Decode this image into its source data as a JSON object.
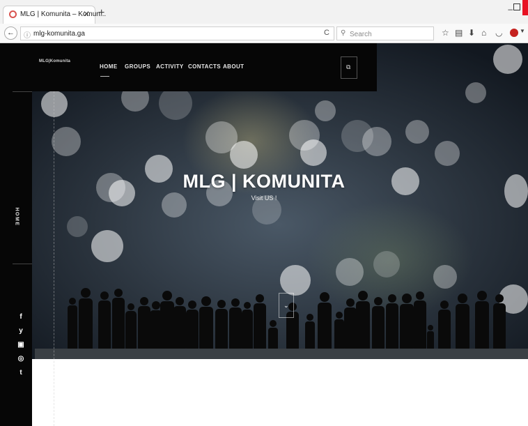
{
  "browser": {
    "tab_title": "MLG | Komunita – Komun...",
    "tab_close": "✕",
    "new_tab": "+",
    "minimize": "–",
    "url": "mlg-komunita.ga",
    "search_placeholder": "Search",
    "back_icon": "←",
    "reload_icon": "C"
  },
  "site": {
    "logo": "MLG|Komunita",
    "menu": [
      {
        "label": "HOME",
        "active": true
      },
      {
        "label": "GROUPS"
      },
      {
        "label": "ACTIVITY"
      },
      {
        "label": "CONTACTS"
      },
      {
        "label": "ABOUT"
      }
    ],
    "sidebar_label": "HOME",
    "social": [
      "f",
      "y",
      "▣",
      "◎",
      "t"
    ]
  },
  "hero": {
    "title": "MLG | KOMUNITA",
    "subtitle": "Visit US !"
  },
  "colors": {
    "accent": "#c5221f",
    "bar": "#060606"
  }
}
